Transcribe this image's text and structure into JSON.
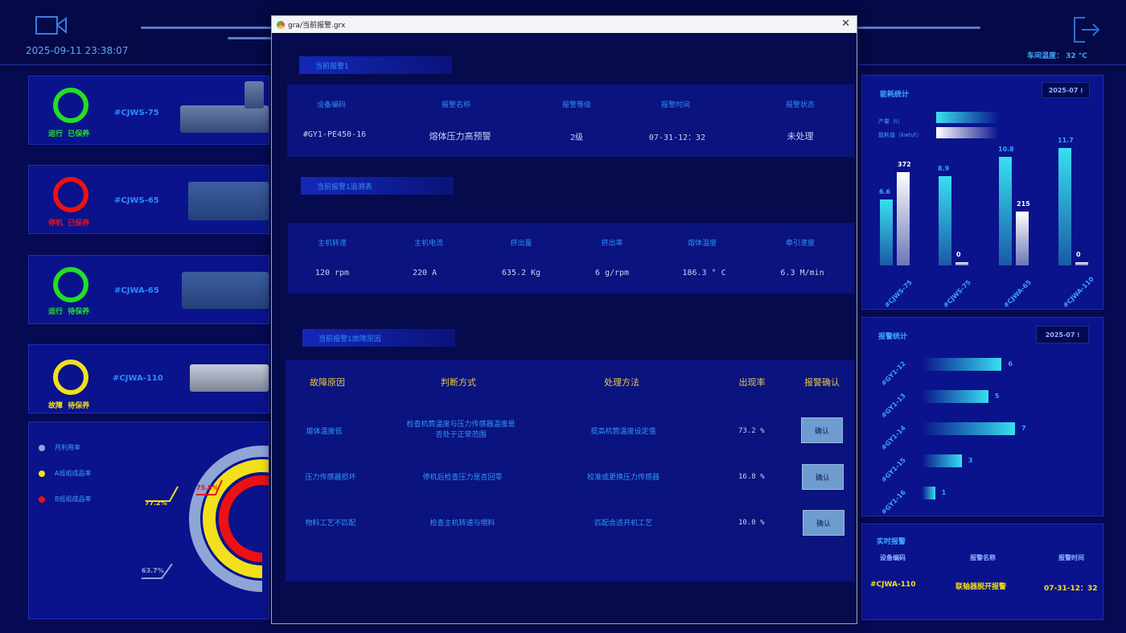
{
  "header": {
    "datetime": "2025-09-11 23:38:07",
    "workshop_temp": "车间温度： 32 °C"
  },
  "devices": [
    {
      "code": "#CJWS-75",
      "status_run": "运行",
      "status_maint": "已保养",
      "ring_color": "#22e022",
      "status_color": "#22e022"
    },
    {
      "code": "#CJWS-65",
      "status_run": "停机",
      "status_maint": "已保养",
      "ring_color": "#ee1111",
      "status_color": "#ee1111"
    },
    {
      "code": "#CJWA-65",
      "status_run": "运行",
      "status_maint": "待保养",
      "ring_color": "#22e022",
      "status_color": "#22e022"
    },
    {
      "code": "#CJWA-110",
      "status_run": "故障",
      "status_maint": "待保养",
      "ring_color": "#f2e01a",
      "status_color": "#f2e01a"
    }
  ],
  "donut": {
    "legend": [
      {
        "label": "月利用率",
        "color": "#8fa5d6"
      },
      {
        "label": "A班组成品率",
        "color": "#f2e01a"
      },
      {
        "label": "B班组成品率",
        "color": "#ee1111"
      }
    ],
    "values": [
      {
        "label": "63.7%",
        "value": 63.7,
        "color": "#8fa5d6"
      },
      {
        "label": "77.2%",
        "value": 77.2,
        "color": "#f2e01a"
      },
      {
        "label": "75.8%",
        "value": 75.8,
        "color": "#ee1111"
      }
    ]
  },
  "modal": {
    "title": "gra/当前报警.grx",
    "close_glyph": "✕",
    "section1": {
      "label": "当前报警1",
      "headers": [
        "设备编码",
        "报警名称",
        "报警等级",
        "报警时间",
        "报警状态"
      ],
      "row": [
        "#GY1-PE450-16",
        "熔体压力高预警",
        "2级",
        "07-31-12：32",
        "未处理"
      ]
    },
    "section2": {
      "label": "当前报警1追溯表",
      "headers": [
        "主机转速",
        "主机电流",
        "挤出量",
        "挤出率",
        "熔体温度",
        "牵引速度"
      ],
      "row": [
        "120 rpm",
        "220 A",
        "635.2 Kg",
        "6 g/rpm",
        "186.3 ° C",
        "6.3 M/min"
      ]
    },
    "section3": {
      "label": "当前报警1故障原因",
      "headers": [
        "故障原因",
        "判断方式",
        "处理方法",
        "出现率",
        "报警确认"
      ],
      "rows": [
        {
          "cause": "熔体温度低",
          "judge": "检查机筒温度与压力传感器温度是否处于正常范围",
          "method": "提高机筒温度设定值",
          "rate": "73.2 %",
          "button": "确认"
        },
        {
          "cause": "压力传感器损坏",
          "judge": "停机后检查压力是否回零",
          "method": "校准或更换压力传感器",
          "rate": "16.8 %",
          "button": "确认"
        },
        {
          "cause": "物料工艺不匹配",
          "judge": "检查主机转速与喂料",
          "method": "匹配合适开机工艺",
          "rate": "10.0 %",
          "button": "确认"
        }
      ]
    }
  },
  "energy": {
    "title": "能耗统计",
    "date": "2025-07 ⁞",
    "legend": [
      {
        "label": "产量（t）",
        "color": "#38e0f0"
      },
      {
        "label": "能耗值（kwh/t）",
        "color": "#ffffff"
      }
    ]
  },
  "chart_data": [
    {
      "type": "bar",
      "title": "能耗统计",
      "categories": [
        "#CJWS-75",
        "#CJWS-75",
        "#CJWA-65",
        "#CJWA-110"
      ],
      "series": [
        {
          "name": "产量（t）",
          "values": [
            6.6,
            8.9,
            10.8,
            11.7
          ],
          "color": "#38e0f0"
        },
        {
          "name": "能耗值（kwh/t）",
          "values": [
            372,
            0,
            215,
            0
          ],
          "color": "#ffffff"
        }
      ],
      "value_labels": [
        [
          "6.6",
          "8.9",
          "10.8",
          "11.7"
        ],
        [
          "372",
          "0",
          "215",
          "0"
        ]
      ]
    },
    {
      "type": "bar",
      "title": "报警统计",
      "categories": [
        "#GY1-12",
        "#GY1-13",
        "#GY1-14",
        "#GY1-15",
        "#GY1-16"
      ],
      "values": [
        6,
        5,
        7,
        3,
        1
      ],
      "orientation": "horizontal",
      "xlim": [
        0,
        7
      ]
    }
  ],
  "alarm_stats": {
    "title": "报警统计",
    "date": "2025-07 ⁞"
  },
  "realtime": {
    "title": "实时报警",
    "headers": [
      "设备编码",
      "报警名称",
      "报警时间"
    ],
    "row": [
      "#CJWA-110",
      "联轴器脱开报警",
      "07-31-12：32"
    ]
  },
  "colors": {
    "accent": "#3fa9ff",
    "bg": "#060a52",
    "panel": "#0a138c"
  }
}
